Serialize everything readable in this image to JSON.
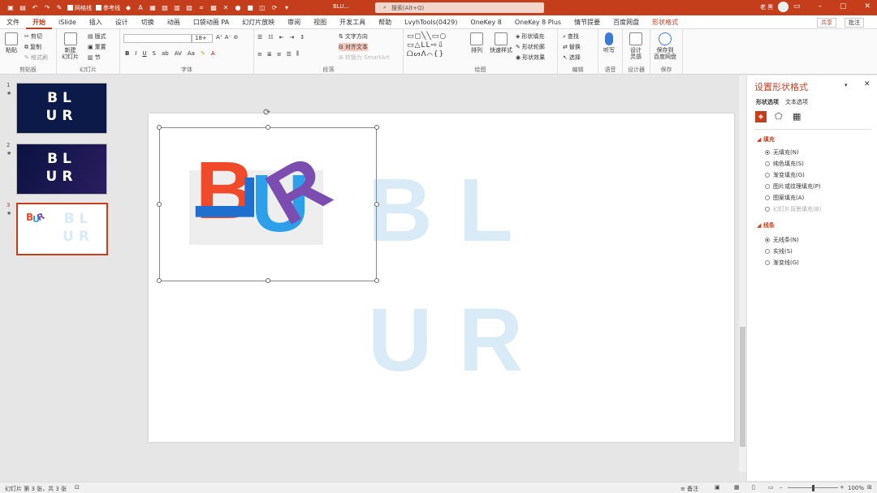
{
  "titlebar": {
    "qat_net_label": "网格线",
    "qat_ref_label": "参考线",
    "doc_title": "BLU...",
    "search_placeholder": "搜索(Alt+Q)",
    "user_name": "老 黑"
  },
  "tabs": [
    "文件",
    "开始",
    "iSlide",
    "插入",
    "设计",
    "切换",
    "动画",
    "口袋动画 PA",
    "幻灯片放映",
    "审阅",
    "视图",
    "开发工具",
    "帮助",
    "LvyhTools(0429)",
    "OneKey 8",
    "OneKey 8 Plus",
    "情节提要",
    "百度网盘",
    "形状格式"
  ],
  "active_tab": "开始",
  "share_label": "共享",
  "comment_label": "批注",
  "ribbon": {
    "clipboard": {
      "label": "剪贴板",
      "paste": "粘贴",
      "cut": "剪切",
      "copy": "复制",
      "format_painter": "格式刷"
    },
    "slides": {
      "label": "幻灯片",
      "new_slide": "新建\n幻灯片",
      "layout": "版式",
      "reset": "重置",
      "section": "节"
    },
    "font": {
      "label": "字体",
      "size": "18+"
    },
    "paragraph": {
      "label": "段落",
      "text_direction": "文字方向",
      "align_text": "对齐文本",
      "smartart": "转换为 SmartArt"
    },
    "drawing": {
      "label": "绘图",
      "arrange": "排列",
      "quick_styles": "快速样式",
      "shape_fill": "形状填充",
      "shape_outline": "形状轮廓",
      "shape_effect": "形状效果"
    },
    "editing": {
      "label": "编辑",
      "find": "查找",
      "replace": "替换",
      "select": "选择"
    },
    "voice": {
      "label": "语音",
      "dictate": "听写"
    },
    "designer": {
      "label": "设计器",
      "design_ideas": "设计\n灵感"
    },
    "save": {
      "label": "保存",
      "save_to_baidu": "保存到\n百度网盘"
    }
  },
  "slides": [
    {
      "num": "1",
      "line1": "BL",
      "line2": "UR"
    },
    {
      "num": "2",
      "line1": "BL",
      "line2": "UR"
    },
    {
      "num": "3",
      "line1": "BL",
      "line2": "UR"
    }
  ],
  "slide_main": {
    "line1": "BL",
    "line2": "UR",
    "art_letters": [
      "B",
      "L",
      "U",
      "R"
    ]
  },
  "colors": {
    "accent": "#c43e1c",
    "letter_red": "#f04a2a",
    "letter_blue": "#1e6fd0",
    "letter_cyan": "#2ca0e8",
    "letter_purple": "#7b4db0",
    "ghost": "#d8ebf7"
  },
  "pane": {
    "title": "设置形状格式",
    "tab_shape": "形状选项",
    "tab_text": "文本选项",
    "fill_section": "填充",
    "fill_options": [
      "无填充(N)",
      "纯色填充(S)",
      "渐变填充(G)",
      "图片或纹理填充(P)",
      "图案填充(A)",
      "幻灯片背景填充(B)"
    ],
    "line_section": "线条",
    "line_options": [
      "无线条(N)",
      "实线(S)",
      "渐变线(G)"
    ]
  },
  "status": {
    "slide_info": "幻灯片 第 3 张，共 3 张",
    "notes": "备注",
    "zoom": "100%"
  }
}
